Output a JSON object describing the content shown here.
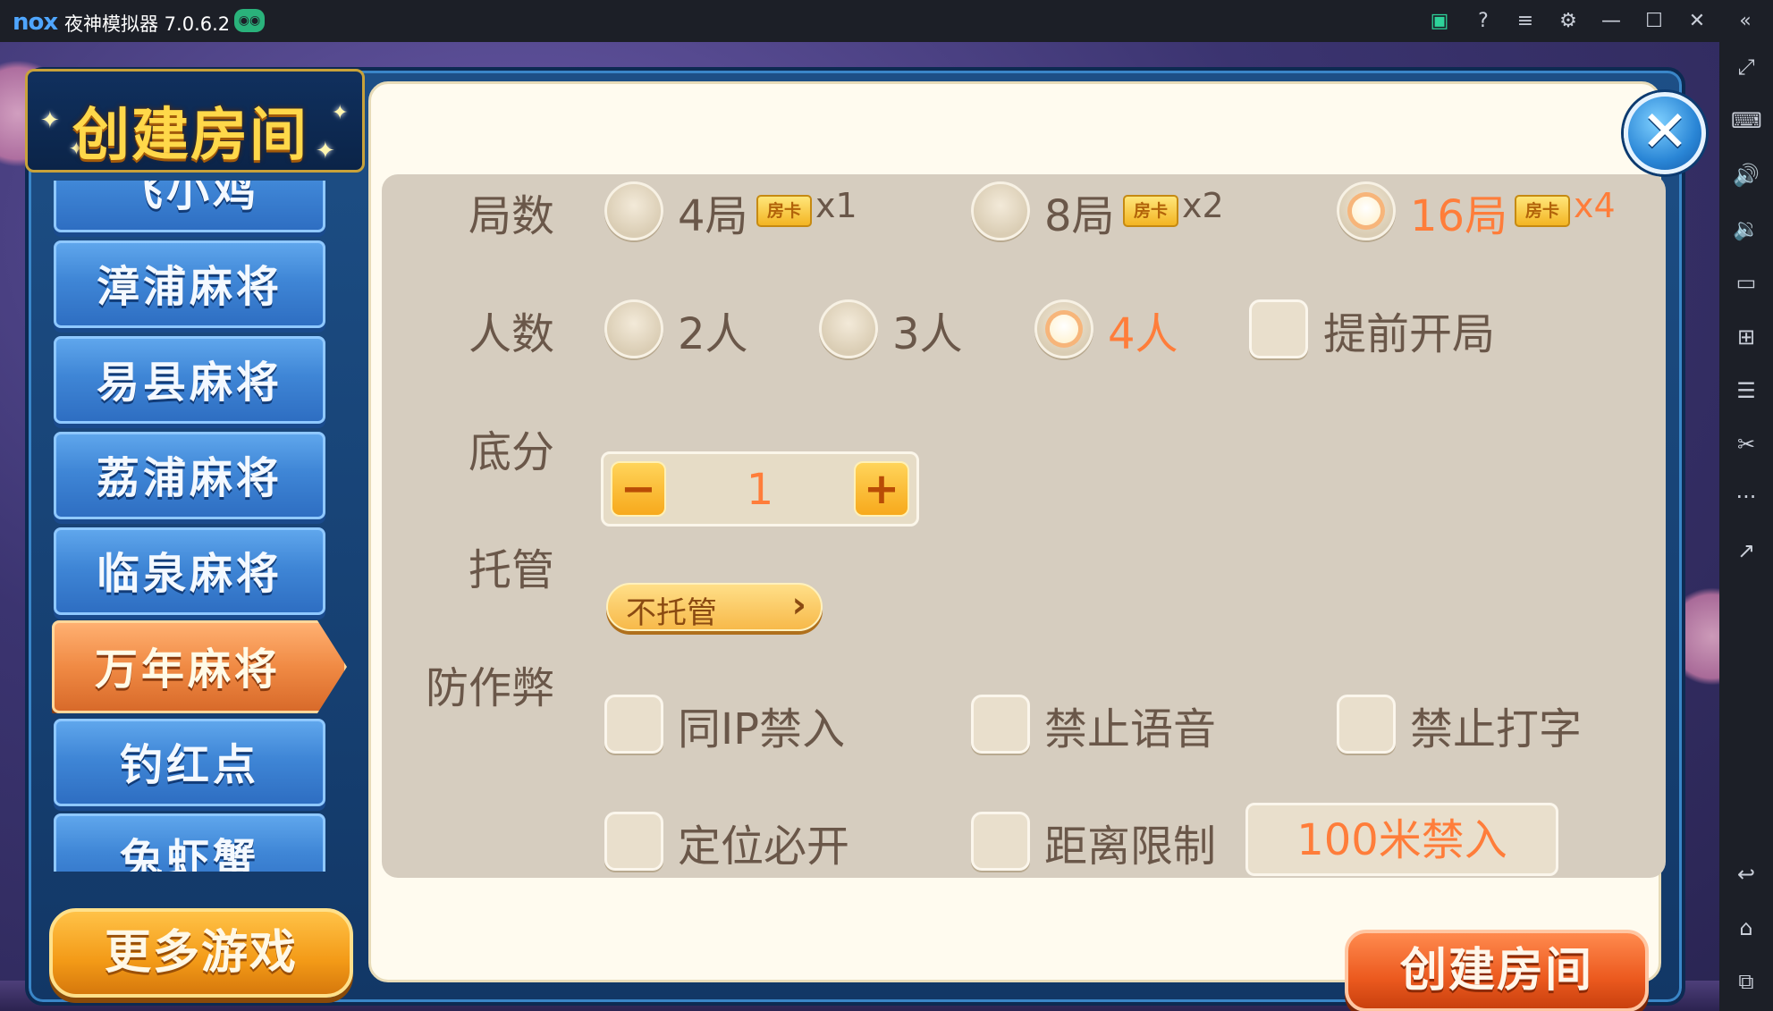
{
  "emulator": {
    "logo": "nox",
    "title": "夜神模拟器 7.0.6.2",
    "toolbar": {
      "store": "▣",
      "help": "?",
      "menu": "≡",
      "settings": "⚙",
      "minimize": "—",
      "maximize": "☐",
      "close": "✕",
      "collapse": "«"
    },
    "sidebar_icons": {
      "fullscreen": "⤢",
      "keyboard": "⌨",
      "volume_up": "🔊",
      "volume_down": "🔉",
      "screen": "▭",
      "apk": "⊞",
      "multi": "☰",
      "scissors": "✂",
      "more": "···",
      "share": "↗",
      "back": "↩",
      "home": "⌂",
      "recent": "⧉"
    }
  },
  "dialog": {
    "title": "创建房间",
    "close_label": "✕",
    "game_menu": [
      {
        "label": "飞小鸡",
        "active": false
      },
      {
        "label": "漳浦麻将",
        "active": false
      },
      {
        "label": "易县麻将",
        "active": false
      },
      {
        "label": "荔浦麻将",
        "active": false
      },
      {
        "label": "临泉麻将",
        "active": false
      },
      {
        "label": "万年麻将",
        "active": true
      },
      {
        "label": "钓红点",
        "active": false
      },
      {
        "label": "兔虾蟹",
        "active": false
      }
    ],
    "more_games": "更多游戏",
    "create_button": "创建房间",
    "options": {
      "rounds": {
        "label": "局数",
        "card_icon": "房卡",
        "choices": [
          {
            "text": "4局",
            "mult": "x1",
            "selected": false
          },
          {
            "text": "8局",
            "mult": "x2",
            "selected": false
          },
          {
            "text": "16局",
            "mult": "x4",
            "selected": true
          }
        ]
      },
      "players": {
        "label": "人数",
        "choices": [
          {
            "text": "2人",
            "selected": false
          },
          {
            "text": "3人",
            "selected": false
          },
          {
            "text": "4人",
            "selected": true
          }
        ],
        "early_start": {
          "text": "提前开局",
          "checked": false
        }
      },
      "base_score": {
        "label": "底分",
        "value": "1",
        "minus": "−",
        "plus": "+"
      },
      "hosting": {
        "label": "托管",
        "value": "不托管",
        "chevron": "›"
      },
      "anti_cheat": {
        "label": "防作弊",
        "checks": [
          {
            "text": "同IP禁入",
            "checked": false
          },
          {
            "text": "禁止语音",
            "checked": false
          },
          {
            "text": "禁止打字",
            "checked": false
          },
          {
            "text": "定位必开",
            "checked": false
          },
          {
            "text": "距离限制",
            "checked": false
          }
        ],
        "distance_value": "100米禁入"
      }
    }
  }
}
